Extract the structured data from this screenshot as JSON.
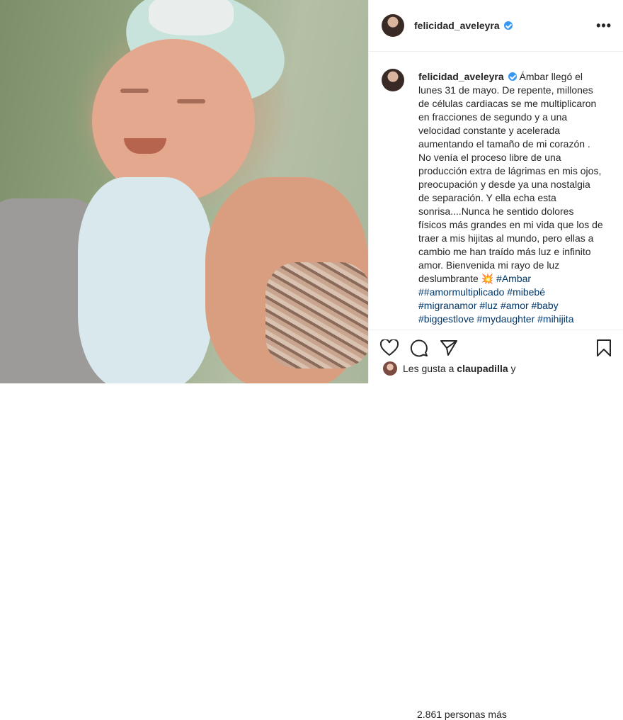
{
  "post": {
    "username": "felicidad_aveleyra",
    "more_icon": "•••",
    "caption": {
      "text": "Ámbar llegó el lunes 31 de mayo. De repente, millones de células cardiacas se me multiplicaron en fracciones de segundo y a una velocidad constante y acelerada aumentando el tamaño de mi corazón . No venía el proceso libre de una producción extra de lágrimas en mis ojos, preocupación y desde ya una nostalgia de separación. Y ella echa esta sonrisa....Nunca he sentido dolores físicos más grandes en mi vida que los de traer a mis hijitas al mundo, pero ellas a cambio me han traído más luz e infinito amor. Bienvenida mi rayo de luz deslumbrante",
      "emoji": "💥",
      "hashtags": [
        "#Ambar",
        "##amormultiplicado",
        "#mibebé",
        "#migranamor",
        "#luz",
        "#amor",
        "#baby",
        "#biggestlove",
        "#mydaughter",
        "#mihijita"
      ]
    },
    "likes": {
      "prefix": "Les gusta a",
      "user": "claupadilla",
      "suffix": "y",
      "overflow": "2.861 personas más"
    }
  },
  "icons": [
    "heart-icon",
    "comment-icon",
    "share-icon",
    "bookmark-icon",
    "verified-icon",
    "more-icon"
  ],
  "colors": {
    "verified": "#3897f0",
    "hashtag": "#00376b",
    "text": "#262626",
    "border": "#efefef"
  }
}
